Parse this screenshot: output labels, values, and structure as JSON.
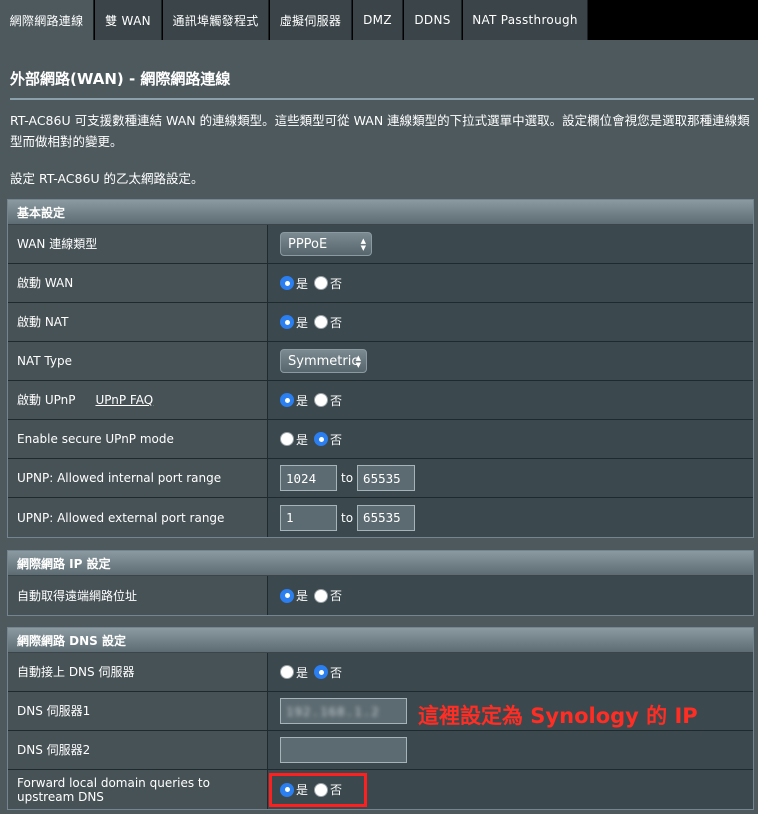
{
  "tabs": [
    {
      "label": "網際網路連線",
      "active": true
    },
    {
      "label": "雙 WAN",
      "active": false
    },
    {
      "label": "通訊埠觸發程式",
      "active": false
    },
    {
      "label": "虛擬伺服器",
      "active": false
    },
    {
      "label": "DMZ",
      "active": false
    },
    {
      "label": "DDNS",
      "active": false
    },
    {
      "label": "NAT Passthrough",
      "active": false
    }
  ],
  "page": {
    "title": "外部網路(WAN) - 網際網路連線",
    "description": "RT-AC86U 可支援數種連結 WAN 的連線類型。這些類型可從 WAN 連線類型的下拉式選單中選取。設定欄位會視您是選取那種連線類型而做相對的變更。",
    "description2": "設定 RT-AC86U 的乙太網路設定。"
  },
  "radio_labels": {
    "yes": "是",
    "no": "否"
  },
  "basic": {
    "header": "基本設定",
    "wan_type_label": "WAN 連線類型",
    "wan_type_value": "PPPoE",
    "enable_wan_label": "啟動 WAN",
    "enable_wan": "yes",
    "enable_nat_label": "啟動 NAT",
    "enable_nat": "yes",
    "nat_type_label": "NAT Type",
    "nat_type_value": "Symmetric",
    "upnp_label": "啟動 UPnP",
    "upnp_faq_link": "UPnP FAQ",
    "upnp": "yes",
    "secure_upnp_label": "Enable secure UPnP mode",
    "secure_upnp": "no",
    "internal_range_label": "UPNP: Allowed internal port range",
    "internal_from": "1024",
    "internal_to": "65535",
    "external_range_label": "UPNP: Allowed external port range",
    "external_from": "1",
    "external_to": "65535",
    "to_label": "to"
  },
  "ip": {
    "header": "網際網路 IP 設定",
    "auto_ip_label": "自動取得遠端網路位址",
    "auto_ip": "yes"
  },
  "dns": {
    "header": "網際網路 DNS 設定",
    "auto_dns_label": "自動接上 DNS 伺服器",
    "auto_dns": "no",
    "dns1_label": "DNS 伺服器1",
    "dns1_value": "192.168.1.2",
    "dns2_label": "DNS 伺服器2",
    "dns2_value": "",
    "forward_label": "Forward local domain queries to upstream DNS",
    "forward": "yes"
  },
  "annotation": "這裡設定為 Synology 的 IP",
  "colors": {
    "accent_blue": "#2b7ff0",
    "annotation_red": "#ff2d23",
    "background": "#4d595d"
  }
}
